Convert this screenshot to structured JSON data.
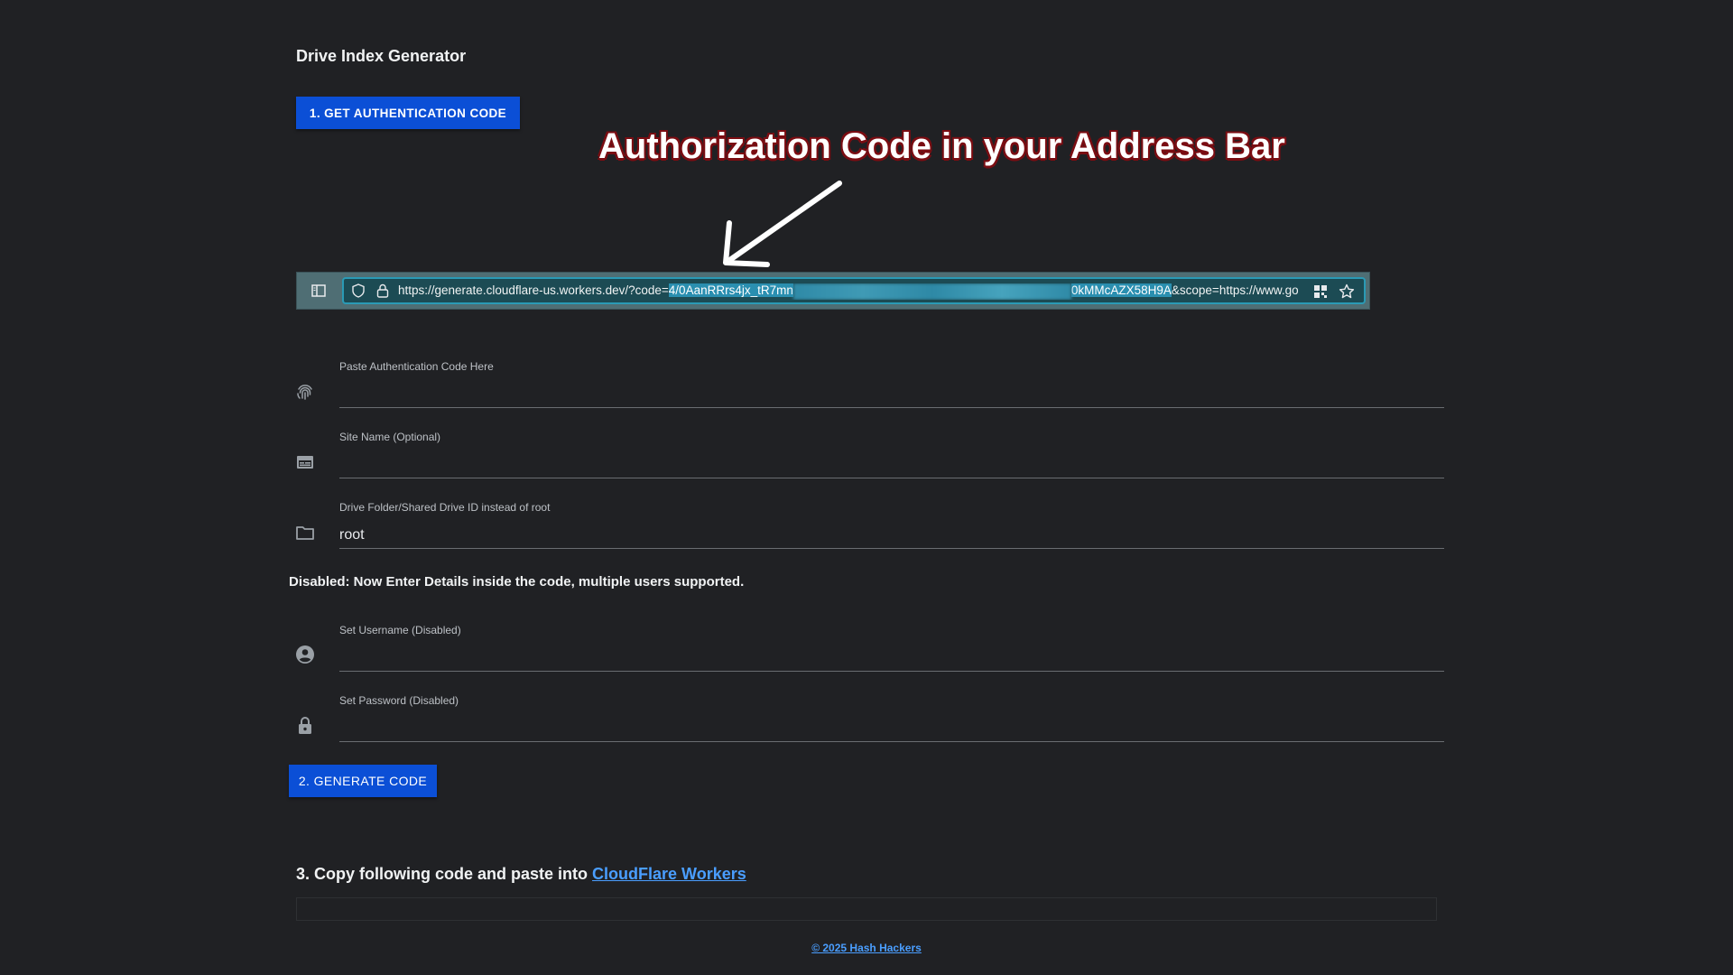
{
  "app": {
    "title": "Drive Index Generator"
  },
  "buttons": {
    "auth": "1. GET AUTHENTICATION CODE",
    "generate": "2. GENERATE CODE"
  },
  "annotation": {
    "text": "Authorization Code in your Address Bar"
  },
  "addressbar": {
    "url_prefix": "https://generate.cloudflare-us.workers.dev/?code=",
    "url_code_start": "4/0AanRRrs4jx_tR7mn",
    "url_code_end": "0kMMcAZX58H9A",
    "url_suffix": "&scope=https://www.go"
  },
  "form": {
    "auth_code": {
      "label": "Paste Authentication Code Here",
      "value": "",
      "icon": "fingerprint-icon"
    },
    "site_name": {
      "label": "Site Name (Optional)",
      "value": "",
      "icon": "web-asset-icon"
    },
    "folder_id": {
      "label": "Drive Folder/Shared Drive ID instead of root",
      "value": "root",
      "icon": "folder-icon"
    },
    "notice": "Disabled: Now Enter Details inside the code, multiple users supported.",
    "username": {
      "label": "Set Username (Disabled)",
      "value": "",
      "icon": "account-circle-icon"
    },
    "password": {
      "label": "Set Password (Disabled)",
      "value": "",
      "icon": "lock-icon"
    }
  },
  "step3": {
    "text": "3. Copy following code and paste into ",
    "link": "CloudFlare Workers"
  },
  "footer": {
    "text": "© 2025 Hash Hackers"
  },
  "colors": {
    "background": "#202124",
    "button": "#0b4fd6",
    "link": "#4a9eff",
    "annotation_outline": "#7a0d12"
  }
}
